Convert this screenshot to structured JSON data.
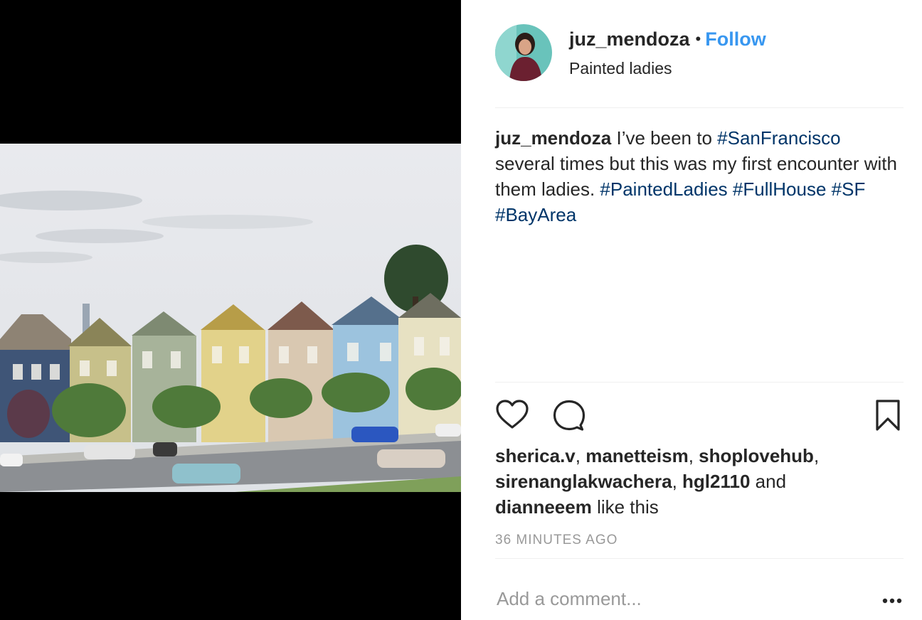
{
  "post": {
    "username": "juz_mendoza",
    "separator": "•",
    "follow_label": "Follow",
    "location": "Painted ladies"
  },
  "caption": {
    "username": "juz_mendoza",
    "text_1": " I’ve been to ",
    "tag_1": "#SanFrancisco",
    "text_2": " several times but this was my first encounter with them ladies. ",
    "tag_2": "#PaintedLadies",
    "tag_3": "#FullHouse",
    "tag_4": "#SF",
    "tag_5": "#BayArea"
  },
  "actions": {
    "like_icon": "heart-icon",
    "comment_icon": "comment-icon",
    "save_icon": "bookmark-icon"
  },
  "likes": {
    "user_1": "sherica.v",
    "user_2": "manetteism",
    "user_3": "shoplovehub",
    "user_4": "sirenanglakwachera",
    "user_5": "hgl2110",
    "and_text": "and",
    "user_6": "dianneeem",
    "suffix": "like this"
  },
  "timestamp": "36 MINUTES AGO",
  "comment": {
    "placeholder": "Add a comment...",
    "more_icon": "more-options-icon"
  },
  "colors": {
    "link_blue": "#3897f0",
    "hashtag": "#003569",
    "muted": "#999999"
  }
}
